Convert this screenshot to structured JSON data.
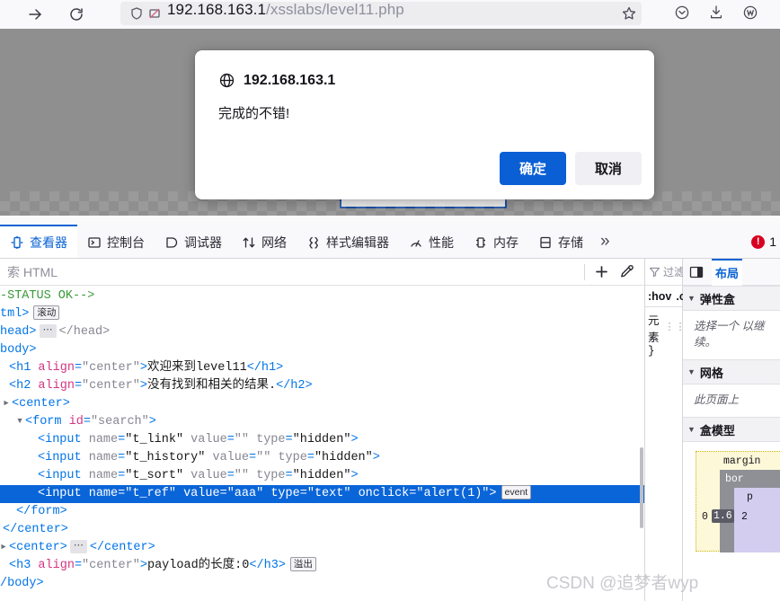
{
  "browser": {
    "forward_icon": "forward-arrow-icon",
    "reload_icon": "reload-icon",
    "shield_icon": "shield-icon",
    "permission_icon": "blocked-permission-icon",
    "url_host": "192.168.163.1",
    "url_path": "/xsslabs/level11.php",
    "star_icon": "bookmark-star-icon",
    "right_icons": [
      "save-to-pocket-icon",
      "downloads-icon",
      "account-icon"
    ]
  },
  "dialog": {
    "globe_icon": "globe-icon",
    "origin": "192.168.163.1",
    "message": "完成的不错!",
    "ok_label": "确定",
    "cancel_label": "取消",
    "primary_color": "#0a5fd4"
  },
  "devtools": {
    "tabs": [
      {
        "label": "查看器",
        "icon": "inspector-icon",
        "active": true
      },
      {
        "label": "控制台",
        "icon": "console-icon",
        "active": false
      },
      {
        "label": "调试器",
        "icon": "debugger-icon",
        "active": false
      },
      {
        "label": "网络",
        "icon": "network-icon",
        "active": false
      },
      {
        "label": "样式编辑器",
        "icon": "style-editor-icon",
        "active": false
      },
      {
        "label": "性能",
        "icon": "performance-icon",
        "active": false
      },
      {
        "label": "内存",
        "icon": "memory-icon",
        "active": false
      },
      {
        "label": "存储",
        "icon": "storage-icon",
        "active": false
      }
    ],
    "overflow_icon": "chevron-double-right-icon",
    "error_count": "1",
    "active_tab_color": "#0a63d4",
    "markup": {
      "search_placeholder": "索 HTML",
      "add_node_icon": "plus-icon",
      "eyedropper_icon": "eyedropper-icon",
      "lines": [
        {
          "indent": 0,
          "type": "comment",
          "text": "-STATUS OK-->"
        },
        {
          "indent": 0,
          "type": "raw",
          "text": "tml>",
          "badge": "滚动"
        },
        {
          "indent": 0,
          "type": "raw",
          "text": "head>",
          "ellipsis": true,
          "close": "</head>"
        },
        {
          "indent": 0,
          "type": "raw",
          "text": "body>"
        },
        {
          "indent": 1,
          "type": "element",
          "tag": "h1",
          "attrs": [
            [
              "align",
              "\"center\""
            ]
          ],
          "text": "欢迎来到level11",
          "close": "</h1>"
        },
        {
          "indent": 1,
          "type": "element",
          "tag": "h2",
          "attrs": [
            [
              "align",
              "\"center\""
            ]
          ],
          "text": "没有找到和相关的结果.",
          "close": "</h2>"
        },
        {
          "indent": 1,
          "type": "open",
          "tag": "center",
          "twisty": true
        },
        {
          "indent": 2,
          "type": "open",
          "tag": "form",
          "attrs": [
            [
              "id",
              "\"search\""
            ]
          ],
          "twisty": true,
          "expanded": true
        },
        {
          "indent": 3,
          "type": "void",
          "tag": "input",
          "attrs": [
            [
              "name",
              "\"t_link\""
            ],
            [
              "value",
              "\"\""
            ],
            [
              "type",
              "\"hidden\""
            ]
          ]
        },
        {
          "indent": 3,
          "type": "void",
          "tag": "input",
          "attrs": [
            [
              "name",
              "\"t_history\""
            ],
            [
              "value",
              "\"\""
            ],
            [
              "type",
              "\"hidden\""
            ]
          ]
        },
        {
          "indent": 3,
          "type": "void",
          "tag": "input",
          "attrs": [
            [
              "name",
              "\"t_sort\""
            ],
            [
              "value",
              "\"\""
            ],
            [
              "type",
              "\"hidden\""
            ]
          ]
        },
        {
          "indent": 3,
          "type": "void",
          "tag": "input",
          "attrs": [
            [
              "name",
              "\"t_ref\""
            ],
            [
              "value",
              "\"aaa\""
            ],
            [
              "type",
              "\"text\""
            ],
            [
              "onclick",
              "\"alert(1)\""
            ]
          ],
          "badge": "event",
          "selected": true
        },
        {
          "indent": 2,
          "type": "close",
          "text": "</form>"
        },
        {
          "indent": 1,
          "type": "close",
          "text": "</center>"
        },
        {
          "indent": 1,
          "type": "open",
          "tag": "center",
          "ellipsis": true,
          "close": "</center>"
        },
        {
          "indent": 1,
          "type": "element",
          "tag": "h3",
          "attrs": [
            [
              "align",
              "\"center\""
            ]
          ],
          "text": "payload的长度:0",
          "close": "</h3>",
          "badge": "溢出"
        },
        {
          "indent": 0,
          "type": "raw",
          "text": "/body>"
        }
      ]
    },
    "rules": {
      "filter_icon": "filter-icon",
      "filter_placeholder": "过滤样",
      "pseudo_hover": ":hov",
      "pseudo_class": ".cl",
      "rule_selector": "元素",
      "rule_grip": "grip-icon",
      "rule_close": "}"
    },
    "layout": {
      "panel_toggle_icon": "panel-toggle-icon",
      "tab_label": "布局",
      "sections": [
        {
          "title": "弹性盒",
          "body": "选择一个\n以继续。"
        },
        {
          "title": "网格",
          "body": "此页面上"
        },
        {
          "title": "盒模型",
          "body": ""
        }
      ],
      "box_model": {
        "margin_label": "margin",
        "border_label": "bor",
        "padding_label": "p",
        "values": [
          "0",
          "1.6",
          "2"
        ],
        "highlight_value": "1.6"
      }
    }
  },
  "watermark": "CSDN @追梦者wyp"
}
